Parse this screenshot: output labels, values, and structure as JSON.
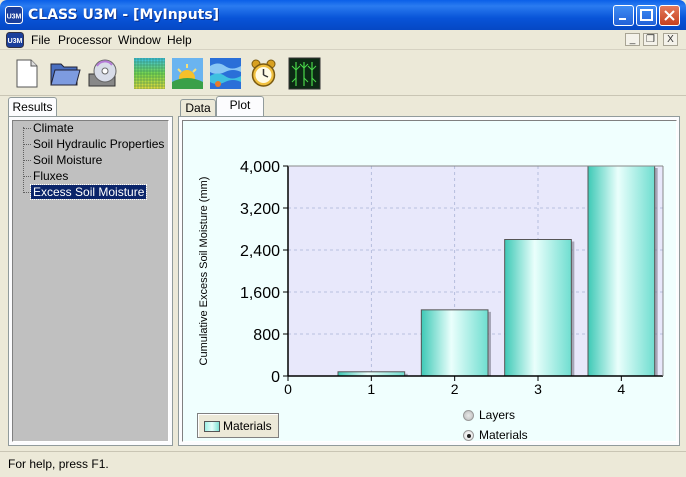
{
  "window": {
    "title": "CLASS U3M - [MyInputs]",
    "app_icon_text": "U3M"
  },
  "menu": {
    "items": [
      "File",
      "Processor",
      "Window",
      "Help"
    ],
    "mdi_controls": [
      "_",
      "❐",
      "X"
    ]
  },
  "toolbar": {
    "buttons": [
      {
        "name": "new-document-icon"
      },
      {
        "name": "open-folder-icon"
      },
      {
        "name": "save-disk-icon"
      },
      {
        "name": "grid-map-icon"
      },
      {
        "name": "sunny-climate-icon"
      },
      {
        "name": "water-layers-icon"
      },
      {
        "name": "alarm-clock-icon"
      },
      {
        "name": "plant-roots-icon"
      }
    ]
  },
  "left_panel": {
    "tab": "Results",
    "tree": [
      "Climate",
      "Soil Hydraulic Properties",
      "Soil Moisture",
      "Fluxes",
      "Excess Soil Moisture"
    ],
    "selected": "Excess Soil Moisture"
  },
  "right_panel": {
    "tabs": [
      "Data",
      "Plot"
    ],
    "active_tab": "Plot",
    "legend_button": "Materials",
    "radio_options": [
      {
        "label": "Layers",
        "checked": false
      },
      {
        "label": "Materials",
        "checked": true
      }
    ]
  },
  "chart_data": {
    "type": "bar",
    "x": [
      1,
      2,
      3,
      4
    ],
    "values": [
      80,
      1260,
      2600,
      4000
    ],
    "ylabel": "Cumulative Excess Soil Moisture (mm)",
    "xlabel": "",
    "xlim": [
      0,
      4.5
    ],
    "ylim": [
      0,
      4000
    ],
    "yticks": [
      "0",
      "800",
      "1,600",
      "2,400",
      "3,200",
      "4,000"
    ],
    "xticks": [
      "0",
      "1",
      "2",
      "3",
      "4"
    ],
    "grid": true,
    "colors": {
      "bar_edge": "#3ec9b6",
      "bar_center": "#eafffc",
      "bar_side": "#6fded0",
      "plot_bg": "#e8e8fb"
    }
  },
  "status": {
    "text": "For help, press F1."
  }
}
